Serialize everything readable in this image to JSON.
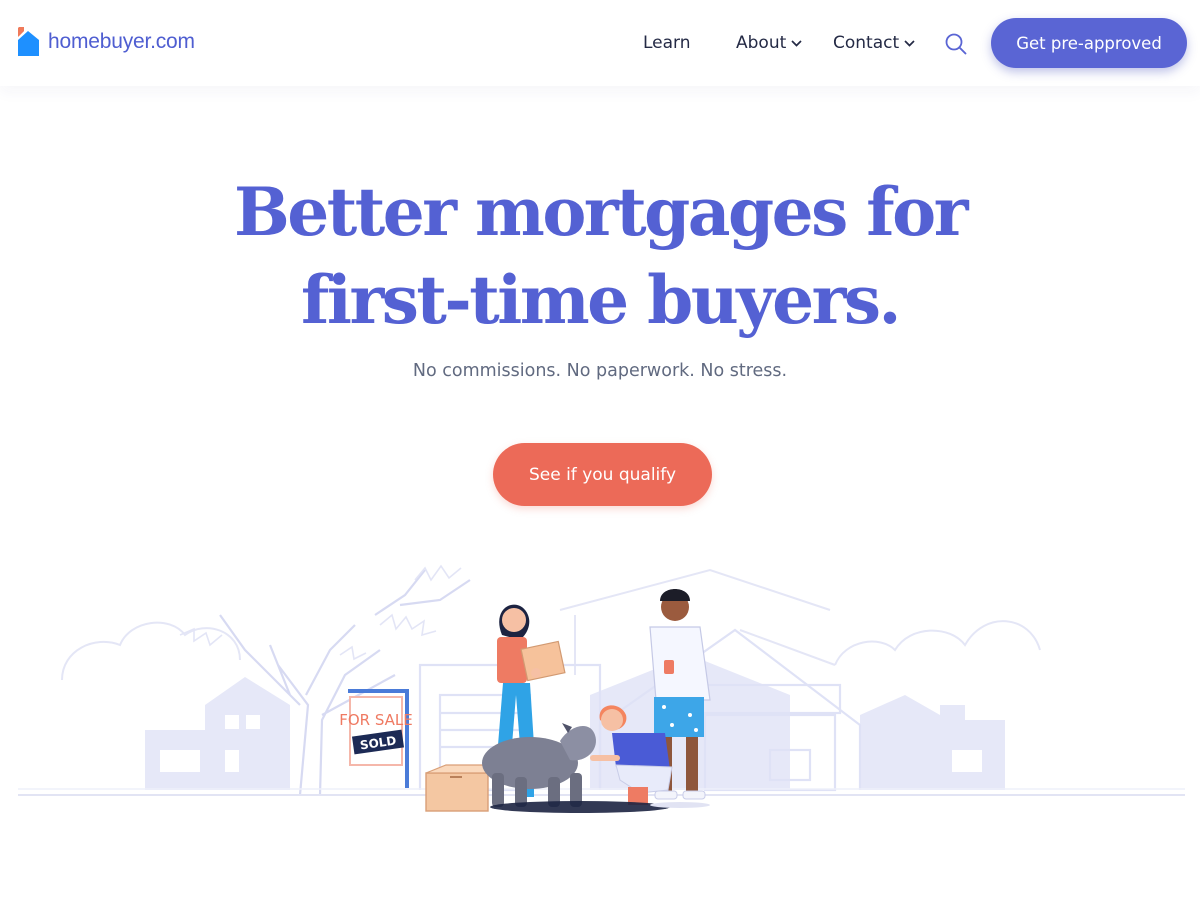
{
  "brand": {
    "name": "homebuyer.com",
    "colors": {
      "primary": "#5461d3",
      "accent": "#ec6a58",
      "logo_blue": "#1e90ff",
      "logo_orange": "#f07a5a"
    }
  },
  "header": {
    "nav": [
      {
        "label": "Learn",
        "has_dropdown": false
      },
      {
        "label": "About",
        "has_dropdown": true
      },
      {
        "label": "Contact",
        "has_dropdown": true
      }
    ],
    "search_icon": "search-icon",
    "cta_label": "Get pre-approved"
  },
  "hero": {
    "title_line1": "Better mortgages for",
    "title_line2": "first-time buyers.",
    "subtitle": "No commissions. No paperwork. No stress.",
    "cta_label": "See if you qualify"
  },
  "illustration": {
    "sign_for_sale": "FOR SALE",
    "sign_sold": "SOLD"
  }
}
